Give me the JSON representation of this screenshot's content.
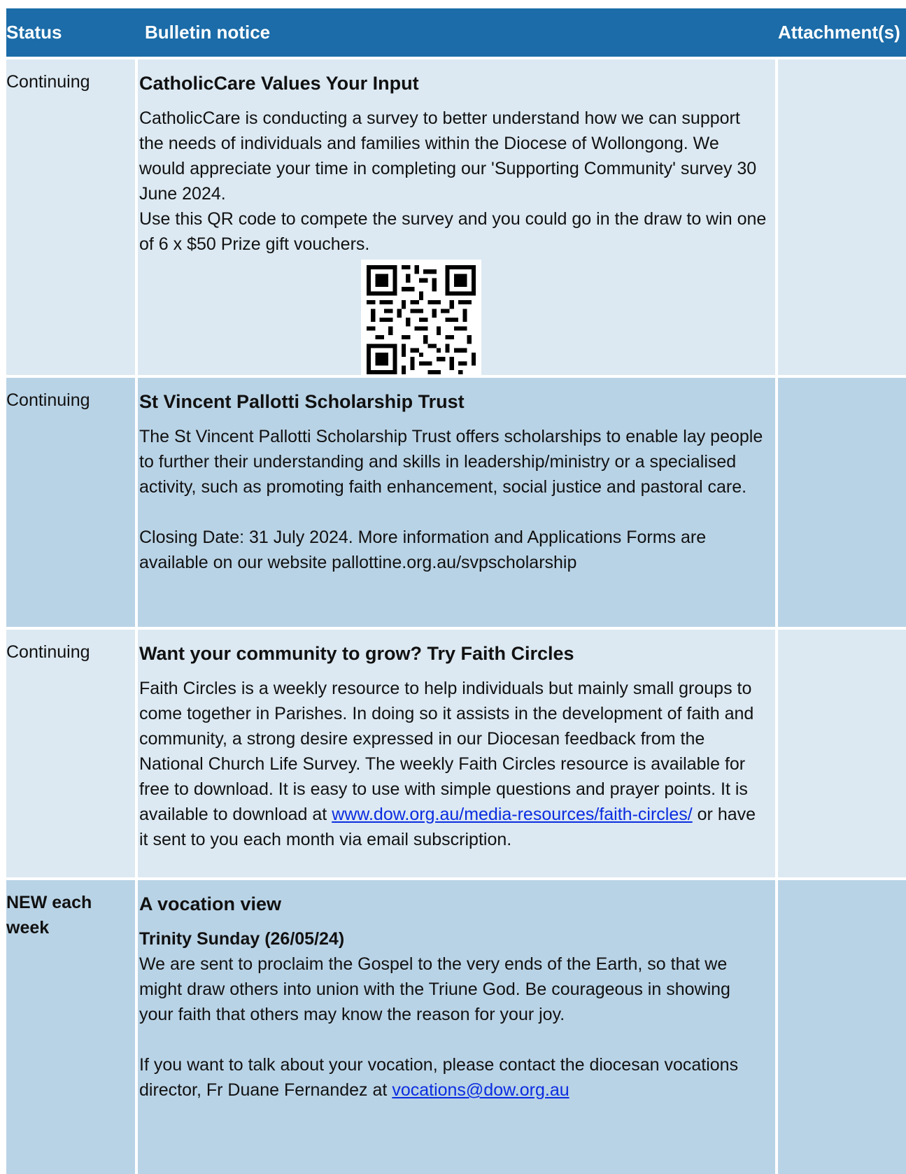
{
  "headers": {
    "status": "Status",
    "notice": "Bulletin notice",
    "attachments": "Attachment(s)"
  },
  "rows": [
    {
      "status": "Continuing",
      "title": "CatholicCare Values Your Input",
      "paragraphs": [
        "CatholicCare is conducting a survey to better understand how we can support the needs of individuals and families within the Diocese of Wollongong. We would appreciate your time in completing our 'Supporting Community' survey 30 June 2024.",
        "Use this QR code to compete the survey and you could go in the draw to win one of 6 x $50 Prize gift vouchers."
      ],
      "qr_icon": "qr-code-icon"
    },
    {
      "status": "Continuing",
      "title": "St Vincent Pallotti Scholarship Trust",
      "paragraphs": [
        "The St Vincent Pallotti Scholarship Trust offers scholarships to enable lay people to further their understanding and skills in leadership/ministry or a specialised activity, such as promoting faith enhancement, social justice and pastoral care.",
        "Closing Date: 31 July 2024. More information and Applications Forms are available on our website pallottine.org.au/svpscholarship"
      ]
    },
    {
      "status": "Continuing",
      "title": "Want your community to grow? Try Faith Circles",
      "paragraph_before_link": "Faith Circles is a weekly resource to help individuals but mainly small groups to come together in Parishes. In doing so it assists in the development of faith and community, a strong desire expressed in our Diocesan feedback from the National Church Life Survey.  The weekly Faith Circles resource is available for free to download. It is easy to use with simple questions and prayer points. It is available to download at",
      "link": "www.dow.org.au/media-resources/faith-circles/",
      "paragraph_after_link": "or have it sent to you each month via email subscription."
    },
    {
      "status": "NEW each week",
      "title": "A vocation view",
      "subtitle": "Trinity Sunday (26/05/24)",
      "paragraphs": [
        "We are sent to proclaim the Gospel to the very ends of the Earth, so that we might draw others into union with the Triune God. Be courageous in showing your faith that others may know the reason for your joy."
      ],
      "contact_text": "If you want to talk about your vocation, please contact the diocesan vocations director, Fr Duane Fernandez at",
      "contact_email": "vocations@dow.org.au"
    }
  ],
  "colors": {
    "header": "#1b6ca8",
    "row_light": "#dce9f2",
    "row_dark": "#b9d3e6",
    "link": "#0b2ce0"
  }
}
